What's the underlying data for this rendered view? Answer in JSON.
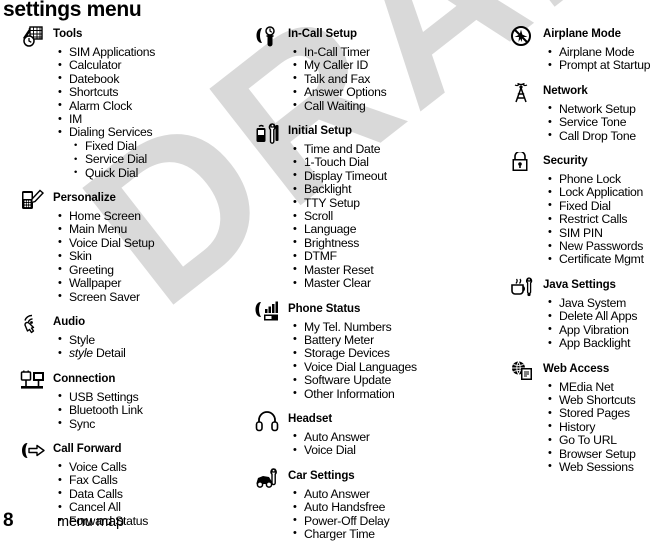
{
  "page": {
    "title": "settings menu",
    "watermark": "DRAFT",
    "footer": {
      "page_number": "8",
      "label": "menu map"
    }
  },
  "columns": [
    {
      "name": "column-1",
      "groups": [
        {
          "icon": "tools-icon",
          "title": "Tools",
          "items": [
            {
              "label": "SIM Applications"
            },
            {
              "label": "Calculator"
            },
            {
              "label": "Datebook"
            },
            {
              "label": "Shortcuts"
            },
            {
              "label": "Alarm Clock"
            },
            {
              "label": "IM"
            },
            {
              "label": "Dialing Services",
              "subitems": [
                {
                  "label": "Fixed Dial"
                },
                {
                  "label": "Service Dial"
                },
                {
                  "label": "Quick Dial"
                }
              ]
            }
          ]
        },
        {
          "icon": "personalize-icon",
          "title": "Personalize",
          "items": [
            {
              "label": "Home Screen"
            },
            {
              "label": "Main Menu"
            },
            {
              "label": "Voice Dial Setup"
            },
            {
              "label": "Skin"
            },
            {
              "label": "Greeting"
            },
            {
              "label": "Wallpaper"
            },
            {
              "label": "Screen Saver"
            }
          ]
        },
        {
          "icon": "audio-icon",
          "title": "Audio",
          "items": [
            {
              "label": "Style"
            },
            {
              "label": "style Detail",
              "italic_prefix": "style",
              "rest": " Detail"
            }
          ]
        },
        {
          "icon": "connection-icon",
          "title": "Connection",
          "items": [
            {
              "label": "USB Settings"
            },
            {
              "label": "Bluetooth Link"
            },
            {
              "label": "Sync"
            }
          ]
        },
        {
          "icon": "call-forward-icon",
          "title": "Call Forward",
          "items": [
            {
              "label": "Voice Calls"
            },
            {
              "label": "Fax Calls"
            },
            {
              "label": "Data Calls"
            },
            {
              "label": "Cancel All"
            },
            {
              "label": "Forward Status"
            }
          ]
        }
      ]
    },
    {
      "name": "column-2",
      "groups": [
        {
          "icon": "in-call-setup-icon",
          "title": "In-Call Setup",
          "items": [
            {
              "label": "In-Call Timer"
            },
            {
              "label": "My Caller ID"
            },
            {
              "label": "Talk and Fax"
            },
            {
              "label": "Answer Options"
            },
            {
              "label": "Call Waiting"
            }
          ]
        },
        {
          "icon": "initial-setup-icon",
          "title": "Initial Setup",
          "items": [
            {
              "label": "Time and Date"
            },
            {
              "label": "1-Touch Dial"
            },
            {
              "label": "Display Timeout"
            },
            {
              "label": "Backlight"
            },
            {
              "label": "TTY Setup"
            },
            {
              "label": "Scroll"
            },
            {
              "label": "Language"
            },
            {
              "label": "Brightness"
            },
            {
              "label": "DTMF"
            },
            {
              "label": "Master Reset"
            },
            {
              "label": "Master Clear"
            }
          ]
        },
        {
          "icon": "phone-status-icon",
          "title": "Phone Status",
          "items": [
            {
              "label": "My Tel. Numbers"
            },
            {
              "label": "Battery Meter"
            },
            {
              "label": "Storage Devices"
            },
            {
              "label": "Voice Dial Languages"
            },
            {
              "label": "Software Update"
            },
            {
              "label": "Other Information"
            }
          ]
        },
        {
          "icon": "headset-icon",
          "title": "Headset",
          "items": [
            {
              "label": "Auto Answer"
            },
            {
              "label": "Voice Dial"
            }
          ]
        },
        {
          "icon": "car-settings-icon",
          "title": "Car Settings",
          "items": [
            {
              "label": "Auto Answer"
            },
            {
              "label": "Auto Handsfree"
            },
            {
              "label": "Power-Off Delay"
            },
            {
              "label": "Charger Time"
            }
          ]
        }
      ]
    },
    {
      "name": "column-3",
      "groups": [
        {
          "icon": "airplane-mode-icon",
          "title": "Airplane Mode",
          "items": [
            {
              "label": "Airplane Mode"
            },
            {
              "label": "Prompt at Startup"
            }
          ]
        },
        {
          "icon": "network-icon",
          "title": "Network",
          "items": [
            {
              "label": "Network Setup"
            },
            {
              "label": "Service Tone"
            },
            {
              "label": "Call Drop Tone"
            }
          ]
        },
        {
          "icon": "security-icon",
          "title": "Security",
          "items": [
            {
              "label": "Phone Lock"
            },
            {
              "label": "Lock Application"
            },
            {
              "label": "Fixed Dial"
            },
            {
              "label": "Restrict Calls"
            },
            {
              "label": "SIM PIN"
            },
            {
              "label": "New Passwords"
            },
            {
              "label": "Certificate Mgmt"
            }
          ]
        },
        {
          "icon": "java-settings-icon",
          "title": "Java Settings",
          "items": [
            {
              "label": "Java System"
            },
            {
              "label": "Delete All Apps"
            },
            {
              "label": "App Vibration"
            },
            {
              "label": "App Backlight"
            }
          ]
        },
        {
          "icon": "web-access-icon",
          "title": "Web Access",
          "items": [
            {
              "label": "MEdia Net"
            },
            {
              "label": "Web Shortcuts"
            },
            {
              "label": "Stored Pages"
            },
            {
              "label": "History"
            },
            {
              "label": "Go To URL"
            },
            {
              "label": "Browser Setup"
            },
            {
              "label": "Web Sessions"
            }
          ]
        }
      ]
    }
  ],
  "colors": {
    "text": "#000000",
    "watermark": "#d9d9d9",
    "background": "#ffffff"
  }
}
